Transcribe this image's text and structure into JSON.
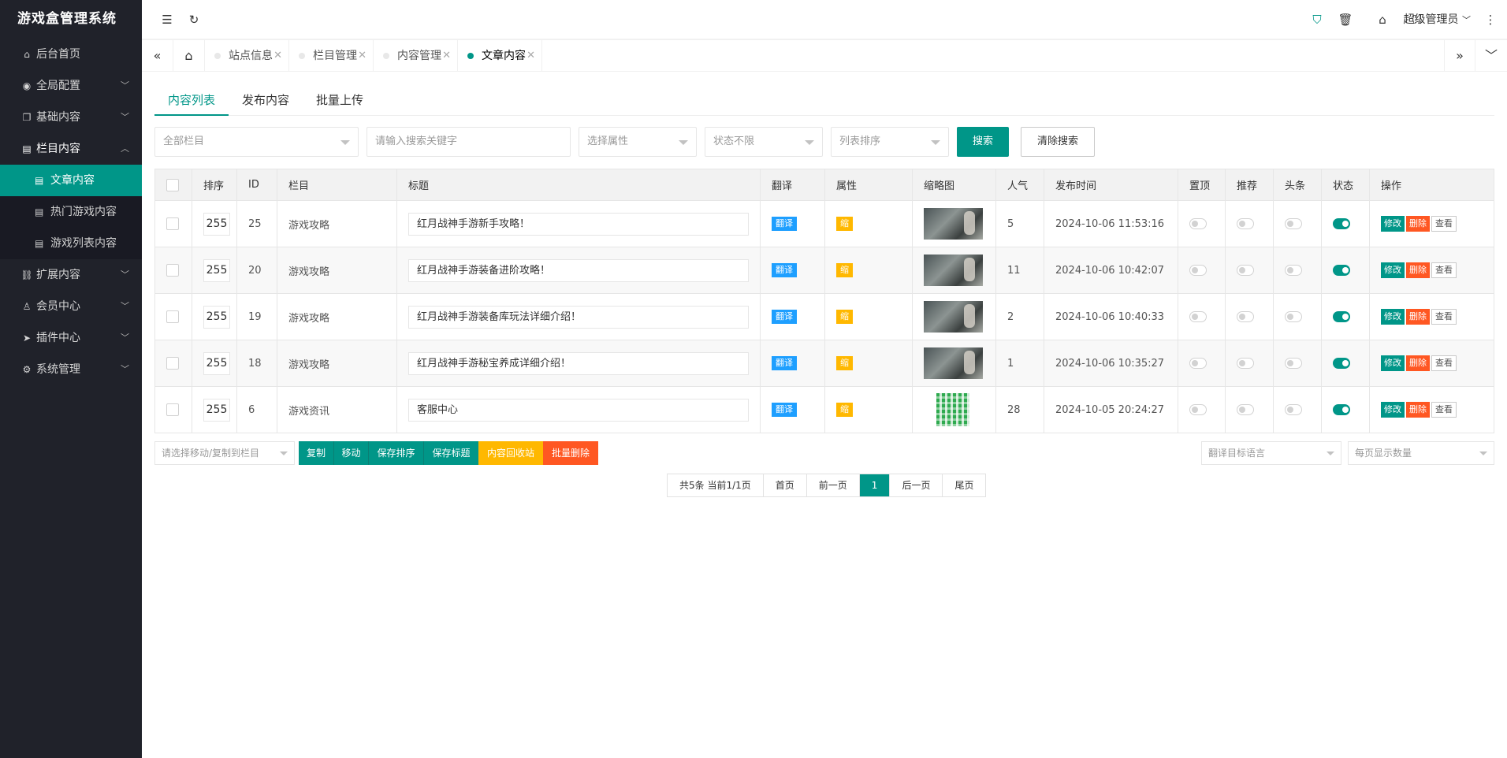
{
  "app": {
    "title": "游戏盒管理系统"
  },
  "sidebar": {
    "items": [
      {
        "label": "后台首页"
      },
      {
        "label": "全局配置"
      },
      {
        "label": "基础内容"
      },
      {
        "label": "栏目内容"
      },
      {
        "label": "扩展内容"
      },
      {
        "label": "会员中心"
      },
      {
        "label": "插件中心"
      },
      {
        "label": "系统管理"
      }
    ],
    "sub_items": [
      {
        "label": "文章内容"
      },
      {
        "label": "热门游戏内容"
      },
      {
        "label": "游戏列表内容"
      }
    ]
  },
  "header": {
    "user": "超级管理员"
  },
  "page_tabs": [
    {
      "label": "站点信息"
    },
    {
      "label": "栏目管理"
    },
    {
      "label": "内容管理"
    },
    {
      "label": "文章内容"
    }
  ],
  "subtabs": [
    {
      "label": "内容列表"
    },
    {
      "label": "发布内容"
    },
    {
      "label": "批量上传"
    }
  ],
  "filters": {
    "column_select": "全部栏目",
    "keyword_placeholder": "请输入搜索关键字",
    "attr_select": "选择属性",
    "status_select": "状态不限",
    "sort_select": "列表排序",
    "search_label": "搜索",
    "clear_label": "清除搜索"
  },
  "table": {
    "headers": [
      "排序",
      "ID",
      "栏目",
      "标题",
      "翻译",
      "属性",
      "缩略图",
      "人气",
      "发布时间",
      "置顶",
      "推荐",
      "头条",
      "状态",
      "操作"
    ],
    "translate_label": "翻译",
    "attr_label": "缩",
    "ops": {
      "edit": "修改",
      "delete": "删除",
      "view": "查看"
    },
    "rows": [
      {
        "sort": "255",
        "id": "25",
        "column": "游戏攻略",
        "title": "红月战神手游新手攻略！",
        "views": "5",
        "date": "2024-10-06 11:53:16"
      },
      {
        "sort": "255",
        "id": "20",
        "column": "游戏攻略",
        "title": "红月战神手游装备进阶攻略！",
        "views": "11",
        "date": "2024-10-06 10:42:07"
      },
      {
        "sort": "255",
        "id": "19",
        "column": "游戏攻略",
        "title": "红月战神手游装备库玩法详细介绍！",
        "views": "2",
        "date": "2024-10-06 10:40:33"
      },
      {
        "sort": "255",
        "id": "18",
        "column": "游戏攻略",
        "title": "红月战神手游秘宝养成详细介绍！",
        "views": "1",
        "date": "2024-10-06 10:35:27"
      },
      {
        "sort": "255",
        "id": "6",
        "column": "游戏资讯",
        "title": "客服中心",
        "views": "28",
        "date": "2024-10-05 20:24:27"
      }
    ]
  },
  "batch": {
    "move_select": "请选择移动/复制到栏目",
    "copy": "复制",
    "move": "移动",
    "save_sort": "保存排序",
    "save_title": "保存标题",
    "recycle": "内容回收站",
    "batch_delete": "批量删除",
    "lang_select": "翻译目标语言",
    "per_page_select": "每页显示数量"
  },
  "pager": {
    "summary": "共5条 当前1/1页",
    "first": "首页",
    "prev": "前一页",
    "current": "1",
    "next": "后一页",
    "last": "尾页"
  },
  "colors": {
    "accent": "#009688",
    "sidebar": "#20222A",
    "blue": "#1E9FFF",
    "yellow": "#FFB800",
    "red": "#FF5722"
  }
}
